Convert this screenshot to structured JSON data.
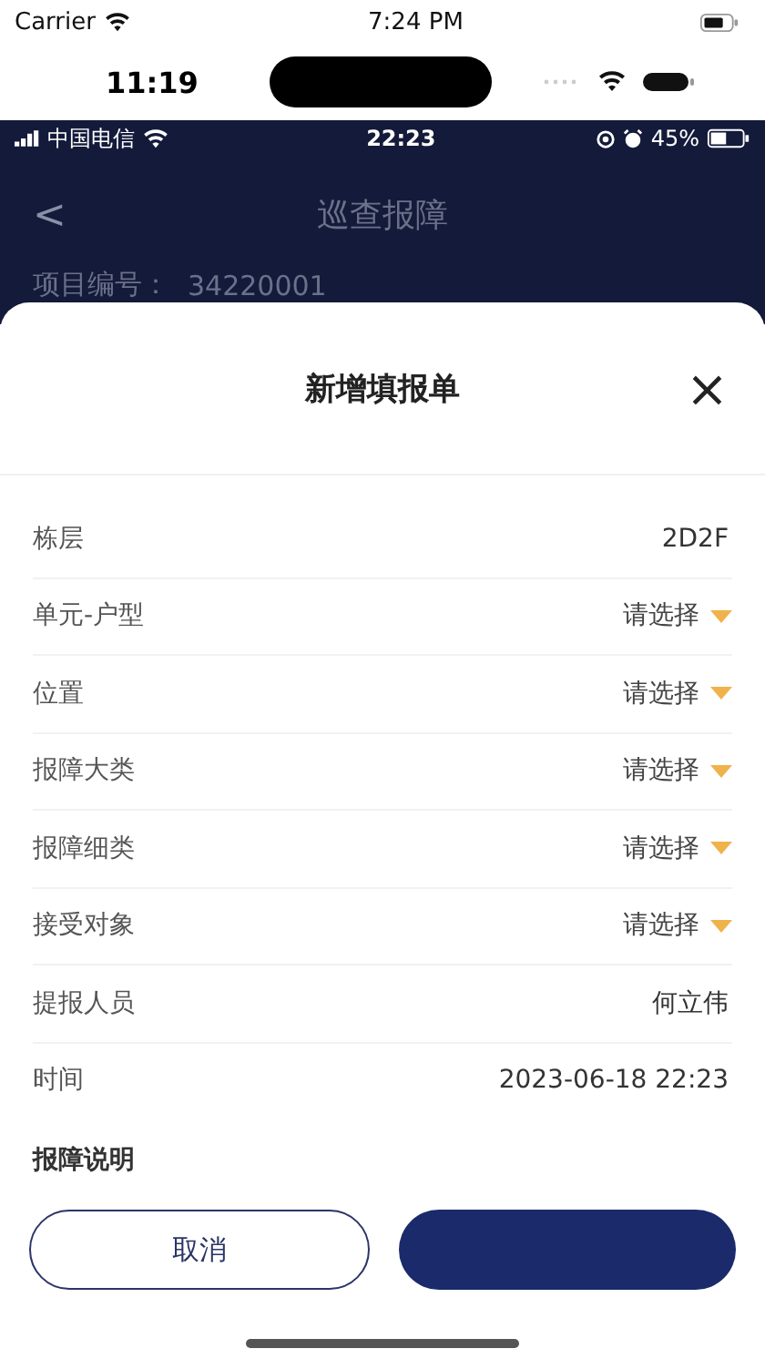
{
  "outer_status": {
    "carrier": "Carrier",
    "time": "7:24 PM"
  },
  "device_status": {
    "time": "11:19"
  },
  "app_status": {
    "carrier": "中国电信",
    "time": "22:23",
    "battery": "45%"
  },
  "nav": {
    "back": "<",
    "title": "巡查报障"
  },
  "project": {
    "label": "项目编号：",
    "value": "34220001"
  },
  "sheet": {
    "title": "新增填报单",
    "close": "×",
    "rows": [
      {
        "kind": "value",
        "label": "栋层",
        "value": "2D2F"
      },
      {
        "kind": "select",
        "label": "单元-户型",
        "value": "请选择"
      },
      {
        "kind": "select",
        "label": "位置",
        "value": "请选择"
      },
      {
        "kind": "select",
        "label": "报障大类",
        "value": "请选择"
      },
      {
        "kind": "select",
        "label": "报障细类",
        "value": "请选择"
      },
      {
        "kind": "select",
        "label": "接受对象",
        "value": "请选择"
      },
      {
        "kind": "value",
        "label": "提报人员",
        "value": "何立伟"
      },
      {
        "kind": "value",
        "label": "时间",
        "value": "2023-06-18 22:23"
      }
    ],
    "description_label": "报障说明",
    "buttons": [
      {
        "kind": "outline",
        "label": "取消"
      },
      {
        "kind": "filled"
      }
    ]
  }
}
